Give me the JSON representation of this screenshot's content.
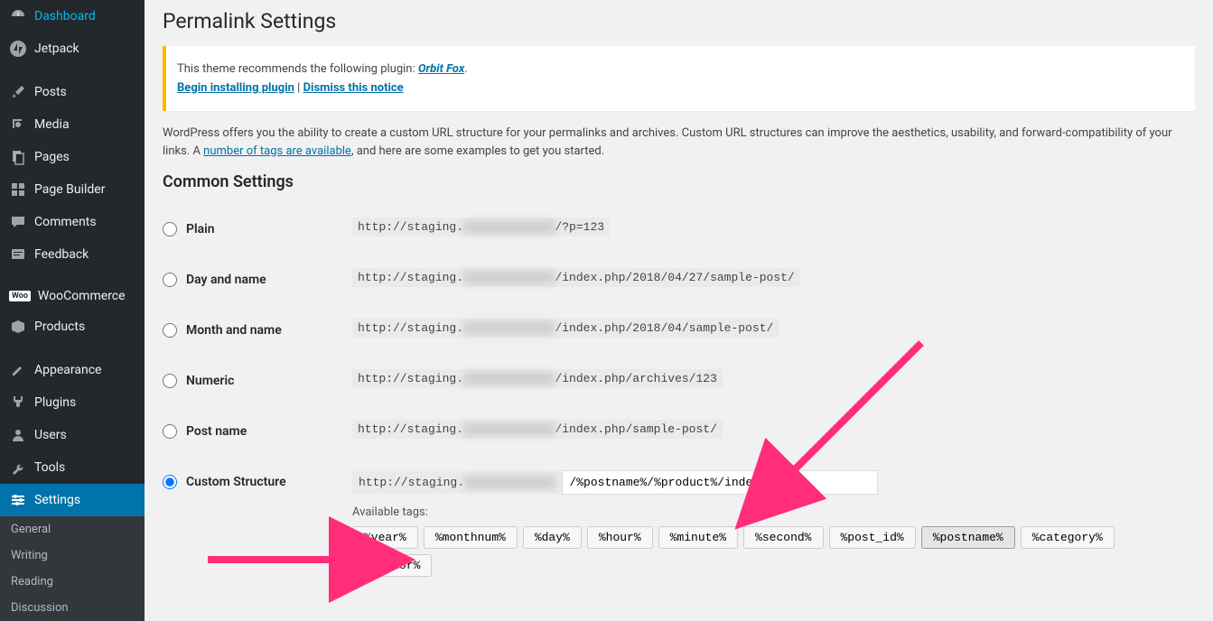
{
  "sidebar": {
    "items": [
      {
        "label": "Dashboard",
        "icon": "dashboard-icon"
      },
      {
        "label": "Jetpack",
        "icon": "jetpack-icon"
      },
      {
        "label": "Posts",
        "icon": "pin-icon"
      },
      {
        "label": "Media",
        "icon": "media-icon"
      },
      {
        "label": "Pages",
        "icon": "pages-icon"
      },
      {
        "label": "Page Builder",
        "icon": "builder-icon"
      },
      {
        "label": "Comments",
        "icon": "comments-icon"
      },
      {
        "label": "Feedback",
        "icon": "feedback-icon"
      },
      {
        "label": "WooCommerce",
        "icon": "woo-icon"
      },
      {
        "label": "Products",
        "icon": "products-icon"
      },
      {
        "label": "Appearance",
        "icon": "appearance-icon"
      },
      {
        "label": "Plugins",
        "icon": "plugins-icon"
      },
      {
        "label": "Users",
        "icon": "users-icon"
      },
      {
        "label": "Tools",
        "icon": "tools-icon"
      },
      {
        "label": "Settings",
        "icon": "settings-icon",
        "active": true
      }
    ],
    "sub": [
      "General",
      "Writing",
      "Reading",
      "Discussion"
    ]
  },
  "page": {
    "title": "Permalink Settings",
    "notice": {
      "recommends": "This theme recommends the following plugin: ",
      "plugin": "Orbit Fox",
      "install": "Begin installing plugin",
      "sep": " | ",
      "dismiss": "Dismiss this notice"
    },
    "description_prefix": "WordPress offers you the ability to create a custom URL structure for your permalinks and archives. Custom URL structures can improve the aesthetics, usability, and forward-compatibility of your links. A ",
    "description_link": "number of tags are available",
    "description_suffix": ", and here are some examples to get you started.",
    "common_settings": "Common Settings",
    "options": [
      {
        "label": "Plain",
        "url_pre": "http://staging.",
        "url_post": "/?p=123"
      },
      {
        "label": "Day and name",
        "url_pre": "http://staging.",
        "url_post": "/index.php/2018/04/27/sample-post/"
      },
      {
        "label": "Month and name",
        "url_pre": "http://staging.",
        "url_post": "/index.php/2018/04/sample-post/"
      },
      {
        "label": "Numeric",
        "url_pre": "http://staging.",
        "url_post": "/index.php/archives/123"
      },
      {
        "label": "Post name",
        "url_pre": "http://staging.",
        "url_post": "/index.php/sample-post/"
      }
    ],
    "custom": {
      "label": "Custom Structure",
      "prefix": "http://staging.",
      "value": "/%postname%/%product%/index.php/",
      "available": "Available tags:"
    },
    "tags": [
      "%year%",
      "%monthnum%",
      "%day%",
      "%hour%",
      "%minute%",
      "%second%",
      "%post_id%",
      "%postname%",
      "%category%",
      "%author%"
    ],
    "redacted": "xxxxxxxxxxxxx"
  }
}
